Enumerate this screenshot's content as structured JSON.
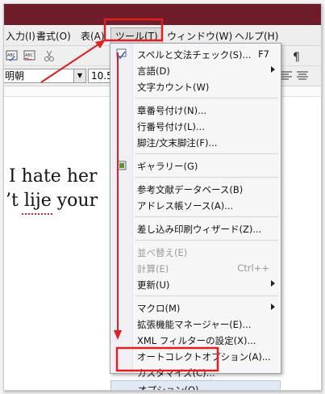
{
  "menubar": {
    "items": [
      "入力(I)",
      "書式(O)",
      "表(A)",
      "ツール(T)",
      "ウィンドウ(W)",
      "ヘルプ(H)"
    ],
    "active": "ツール(T)"
  },
  "toolbar": {
    "font_name": "明朝",
    "font_size": "10.5"
  },
  "document": {
    "lines": [
      "I hate her",
      "’t lije your"
    ]
  },
  "tools_menu": {
    "items": [
      {
        "label": "スペルと文法チェック(S)...",
        "shortcut": "F7",
        "icon": "spellcheck-icon"
      },
      {
        "label": "言語(D)",
        "submenu": true
      },
      {
        "label": "文字カウント(W)"
      },
      {
        "separator": true
      },
      {
        "label": "章番号付け(N)..."
      },
      {
        "label": "行番号付け(L)..."
      },
      {
        "label": "脚注/文末脚注(F)..."
      },
      {
        "separator": true
      },
      {
        "label": "ギャラリー(G)",
        "icon": "gallery-icon"
      },
      {
        "separator": true
      },
      {
        "label": "参考文献データベース(B)"
      },
      {
        "label": "アドレス帳ソース(A)..."
      },
      {
        "separator": true
      },
      {
        "label": "差し込み印刷ウィザード(Z)..."
      },
      {
        "separator": true
      },
      {
        "label": "並べ替え(E)",
        "disabled": true
      },
      {
        "label": "計算(E)",
        "shortcut": "Ctrl++",
        "disabled": true
      },
      {
        "label": "更新(U)",
        "submenu": true
      },
      {
        "separator": true
      },
      {
        "label": "マクロ(M)",
        "submenu": true
      },
      {
        "label": "拡張機能マネージャー(E)..."
      },
      {
        "label": "XML フィルターの設定(X)..."
      },
      {
        "label": "オートコレクトオプション(A)..."
      },
      {
        "label": "カスタマイズ(C)..."
      },
      {
        "label": "オプション(O)...",
        "highlighted": true
      }
    ]
  },
  "annotation_color": "#e02020"
}
